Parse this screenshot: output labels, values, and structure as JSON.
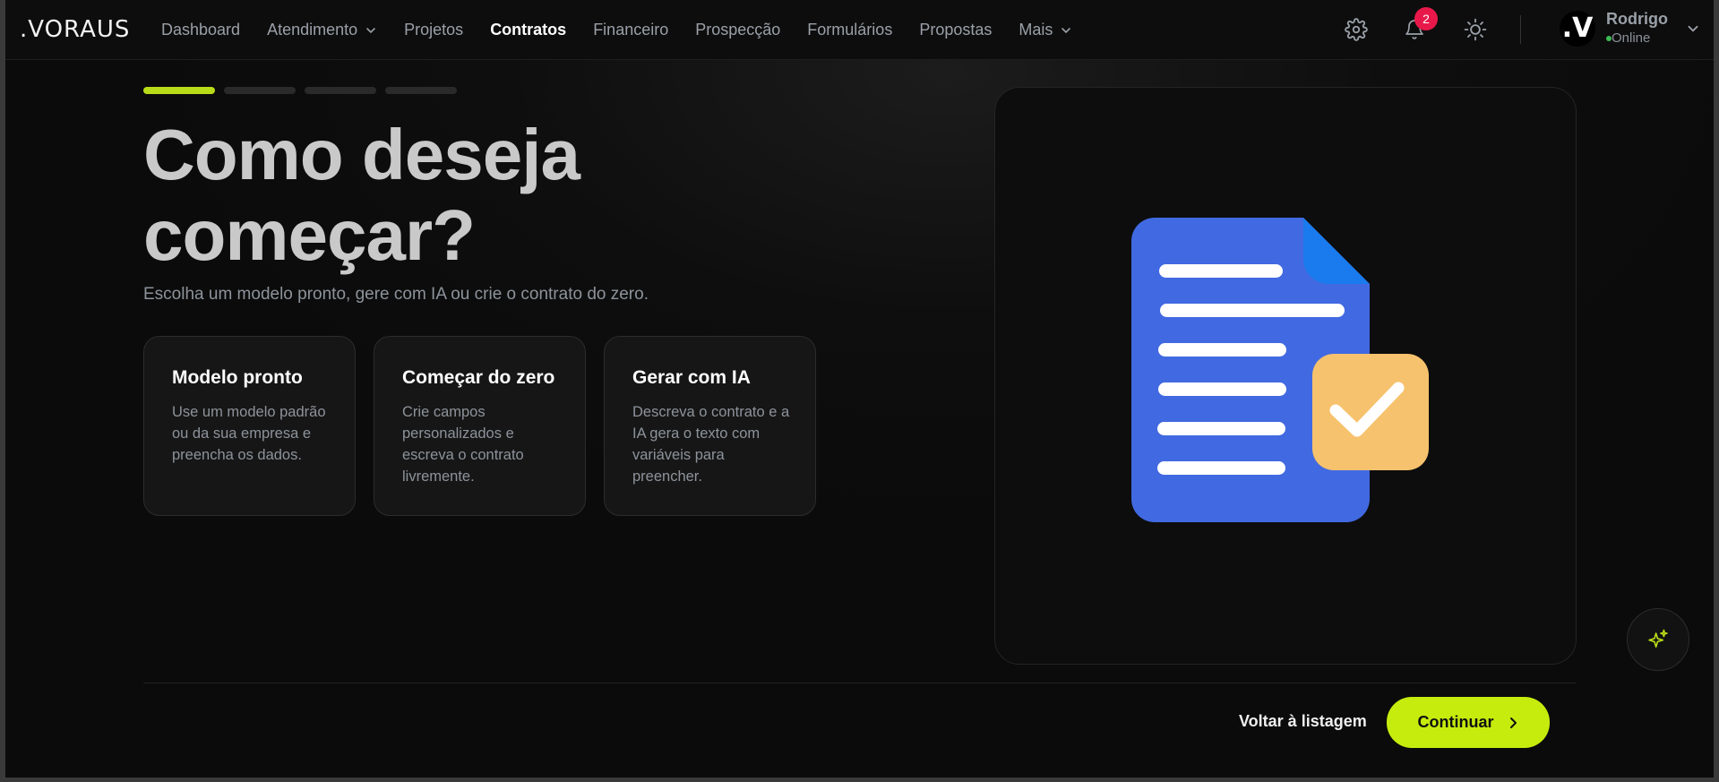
{
  "app": {
    "logo": ".VORAUS"
  },
  "nav": {
    "items": [
      {
        "label": "Dashboard"
      },
      {
        "label": "Atendimento"
      },
      {
        "label": "Projetos"
      },
      {
        "label": "Contratos"
      },
      {
        "label": "Financeiro"
      },
      {
        "label": "Prospecção"
      },
      {
        "label": "Formulários"
      },
      {
        "label": "Propostas"
      },
      {
        "label": "Mais"
      }
    ],
    "active": "Contratos",
    "notifications_count": "2",
    "icons": [
      "gear-icon",
      "bell-icon",
      "sun-icon",
      "chevron-down-icon"
    ]
  },
  "user": {
    "avatar_text": ".V",
    "name": "Rodrigo",
    "status": "Online"
  },
  "wizard": {
    "steps_total": 4,
    "current_step": 1,
    "title": "Como deseja começar?",
    "subtitle": "Escolha um modelo pronto, gere com IA ou crie o contrato do zero.",
    "options": [
      {
        "title": "Modelo pronto",
        "description": "Use um modelo padrão ou da sua empresa e preencha os dados."
      },
      {
        "title": "Começar do zero",
        "description": "Crie campos personalizados e escreva o contrato livremente."
      },
      {
        "title": "Gerar com IA",
        "description": "Descreva o contrato e a IA gera o texto com variáveis para preencher."
      }
    ]
  },
  "footer": {
    "back_label": "Voltar à listagem",
    "continue_label": "Continuar"
  },
  "colors": {
    "accent": "#c6ec0e",
    "step_active": "#b9dc18",
    "badge": "#e8194a",
    "doc_blue": "#4169e1",
    "doc_corner": "#1a7bef",
    "check_bg": "#f7c26d",
    "online": "#3dbb55"
  }
}
